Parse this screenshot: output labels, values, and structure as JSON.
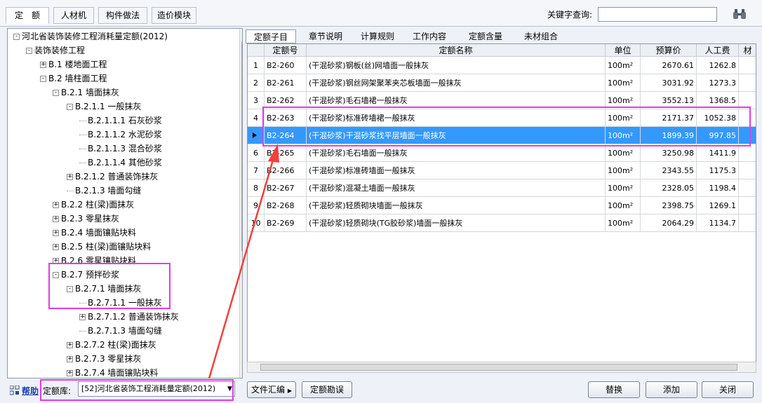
{
  "top_tabs": [
    "定　额",
    "人材机",
    "构件做法",
    "造价模块"
  ],
  "keyword_label": "关键字查询:",
  "keyword_value": "",
  "tree": [
    {
      "label": "河北省装饰装修工程消耗量定额(2012)",
      "lvl": 0,
      "exp": "-"
    },
    {
      "label": "装饰装修工程",
      "lvl": 1,
      "exp": "-"
    },
    {
      "label": "B.1 楼地面工程",
      "lvl": 2,
      "exp": "+"
    },
    {
      "label": "B.2 墙柱面工程",
      "lvl": 2,
      "exp": "-"
    },
    {
      "label": "B.2.1 墙面抹灰",
      "lvl": 3,
      "exp": "-"
    },
    {
      "label": "B.2.1.1 一般抹灰",
      "lvl": 4,
      "exp": "-"
    },
    {
      "label": "B.2.1.1.1 石灰砂浆",
      "lvl": 5,
      "exp": ""
    },
    {
      "label": "B.2.1.1.2 水泥砂浆",
      "lvl": 5,
      "exp": ""
    },
    {
      "label": "B.2.1.1.3 混合砂浆",
      "lvl": 5,
      "exp": ""
    },
    {
      "label": "B.2.1.1.4 其他砂浆",
      "lvl": 5,
      "exp": ""
    },
    {
      "label": "B.2.1.2 普通装饰抹灰",
      "lvl": 4,
      "exp": "+"
    },
    {
      "label": "B.2.1.3 墙面勾缝",
      "lvl": 4,
      "exp": ""
    },
    {
      "label": "B.2.2 柱(梁)面抹灰",
      "lvl": 3,
      "exp": "+"
    },
    {
      "label": "B.2.3 零星抹灰",
      "lvl": 3,
      "exp": "+"
    },
    {
      "label": "B.2.4 墙面镶贴块料",
      "lvl": 3,
      "exp": "+"
    },
    {
      "label": "B.2.5 柱(梁)面镶贴块料",
      "lvl": 3,
      "exp": "+"
    },
    {
      "label": "B.2.6 零星镶贴块料",
      "lvl": 3,
      "exp": "+"
    },
    {
      "label": "B.2.7 预拌砂浆",
      "lvl": 3,
      "exp": "-"
    },
    {
      "label": "B.2.7.1 墙面抹灰",
      "lvl": 4,
      "exp": "-"
    },
    {
      "label": "B.2.7.1.1 一般抹灰",
      "lvl": 5,
      "exp": ""
    },
    {
      "label": "B.2.7.1.2 普通装饰抹灰",
      "lvl": 5,
      "exp": "+"
    },
    {
      "label": "B.2.7.1.3 墙面勾缝",
      "lvl": 5,
      "exp": ""
    },
    {
      "label": "B.2.7.2 柱(梁)面抹灰",
      "lvl": 4,
      "exp": "+"
    },
    {
      "label": "B.2.7.3 零星抹灰",
      "lvl": 4,
      "exp": "+"
    },
    {
      "label": "B.2.7.4 墙面镶贴块料",
      "lvl": 4,
      "exp": "+"
    }
  ],
  "right_tabs": [
    "定额子目",
    "章节说明",
    "计算规则",
    "工作内容",
    "定额含量",
    "未材组合"
  ],
  "columns": [
    "",
    "定额号",
    "定额名称",
    "单位",
    "预算价",
    "人工费",
    "材"
  ],
  "rows": [
    {
      "no": "1",
      "code": "B2-260",
      "name": "(干混砂浆)钢板(丝)网墙面一般抹灰",
      "unit": "100m²",
      "price": "2670.61",
      "labor": "1262.8",
      "sel": false
    },
    {
      "no": "2",
      "code": "B2-261",
      "name": "(干混砂浆)钢丝网架聚苯夹芯板墙面一般抹灰",
      "unit": "100m²",
      "price": "3031.92",
      "labor": "1273.3",
      "sel": false
    },
    {
      "no": "3",
      "code": "B2-262",
      "name": "(干混砂浆)毛石墙裙一般抹灰",
      "unit": "100m²",
      "price": "3552.13",
      "labor": "1368.5",
      "sel": false
    },
    {
      "no": "4",
      "code": "B2-263",
      "name": "(干混砂浆)标准砖墙裙一般抹灰",
      "unit": "100m²",
      "price": "2171.37",
      "labor": "1052.38",
      "sel": false
    },
    {
      "no": "",
      "code": "B2-264",
      "name": "(干混砂浆)干混砂浆找平层墙面一般抹灰",
      "unit": "100m²",
      "price": "1899.39",
      "labor": "997.85",
      "sel": true
    },
    {
      "no": "6",
      "code": "B2-265",
      "name": "(干混砂浆)毛石墙面一般抹灰",
      "unit": "100m²",
      "price": "3250.98",
      "labor": "1411.9",
      "sel": false
    },
    {
      "no": "7",
      "code": "B2-266",
      "name": "(干混砂浆)标准砖墙面一般抹灰",
      "unit": "100m²",
      "price": "2343.55",
      "labor": "1175.3",
      "sel": false
    },
    {
      "no": "8",
      "code": "B2-267",
      "name": "(干混砂浆)混凝土墙面一般抹灰",
      "unit": "100m²",
      "price": "2328.05",
      "labor": "1198.4",
      "sel": false
    },
    {
      "no": "9",
      "code": "B2-268",
      "name": "(干混砂浆)轻质砌块墙面一般抹灰",
      "unit": "100m²",
      "price": "2398.75",
      "labor": "1269.1",
      "sel": false
    },
    {
      "no": "10",
      "code": "B2-269",
      "name": "(干混砂浆)轻质砌块(TG胶砂浆)墙面一般抹灰",
      "unit": "100m²",
      "price": "2064.29",
      "labor": "1134.7",
      "sel": false
    }
  ],
  "help_label": "帮助",
  "library_label": "定额库:",
  "library_value": "[52]河北省装饰工程消耗量定额(2012)",
  "buttons": {
    "file": "文件汇编",
    "errata": "定额勘误",
    "replace": "替换",
    "add": "添加",
    "close": "关闭"
  },
  "colors": {
    "highlight": "#e03ce6",
    "selection": "#3399ff",
    "arrow": "#f0403c"
  }
}
